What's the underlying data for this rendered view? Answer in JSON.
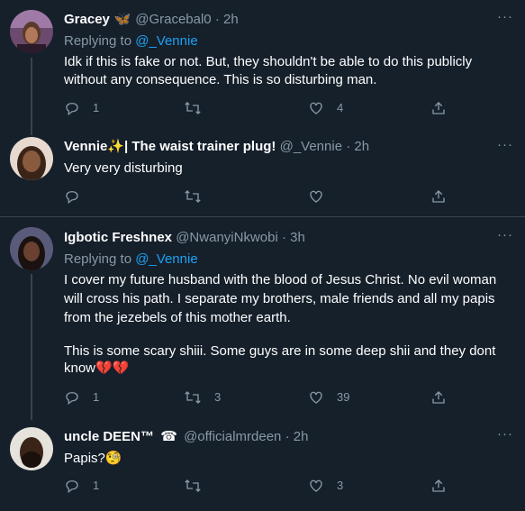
{
  "tweets": [
    {
      "name": "Gracey",
      "badge": "🦋",
      "handle": "@Gracebal0",
      "time": "· 2h",
      "replying_label": "Replying to",
      "replying_to": "@_Vennie",
      "body": "Idk if this is fake or not. But, they shouldn't be able to do this publicly without any consequence. This is so disturbing man.",
      "replies": "1",
      "retweets": "",
      "likes": "4"
    },
    {
      "name": "Vennie✨| The waist trainer plug!",
      "handle": "@_Vennie",
      "time": "· 2h",
      "body": "Very very disturbing",
      "replies": "",
      "retweets": "",
      "likes": ""
    },
    {
      "name": "Igbotic Freshnex",
      "handle": "@NwanyiNkwobi",
      "time": "· 3h",
      "replying_label": "Replying to",
      "replying_to": "@_Vennie",
      "body": "I cover my future husband with the blood of Jesus Christ. No evil woman will cross his path. I separate my brothers, male friends and all my papis from the jezebels of this mother earth.",
      "body2": "This is some scary shiii. Some guys are in some deep shii and they dont know💔💔",
      "replies": "1",
      "retweets": "3",
      "likes": "39"
    },
    {
      "name": "uncle DEEN™",
      "badge": "☎",
      "handle": "@officialmrdeen",
      "time": "· 2h",
      "body": "Papis?🧐",
      "replies": "1",
      "retweets": "",
      "likes": "3"
    }
  ],
  "more_glyph": "···",
  "colors": {
    "background": "#15202b",
    "muted": "#8899a6",
    "link": "#1da1f2",
    "divider": "#38444d"
  }
}
